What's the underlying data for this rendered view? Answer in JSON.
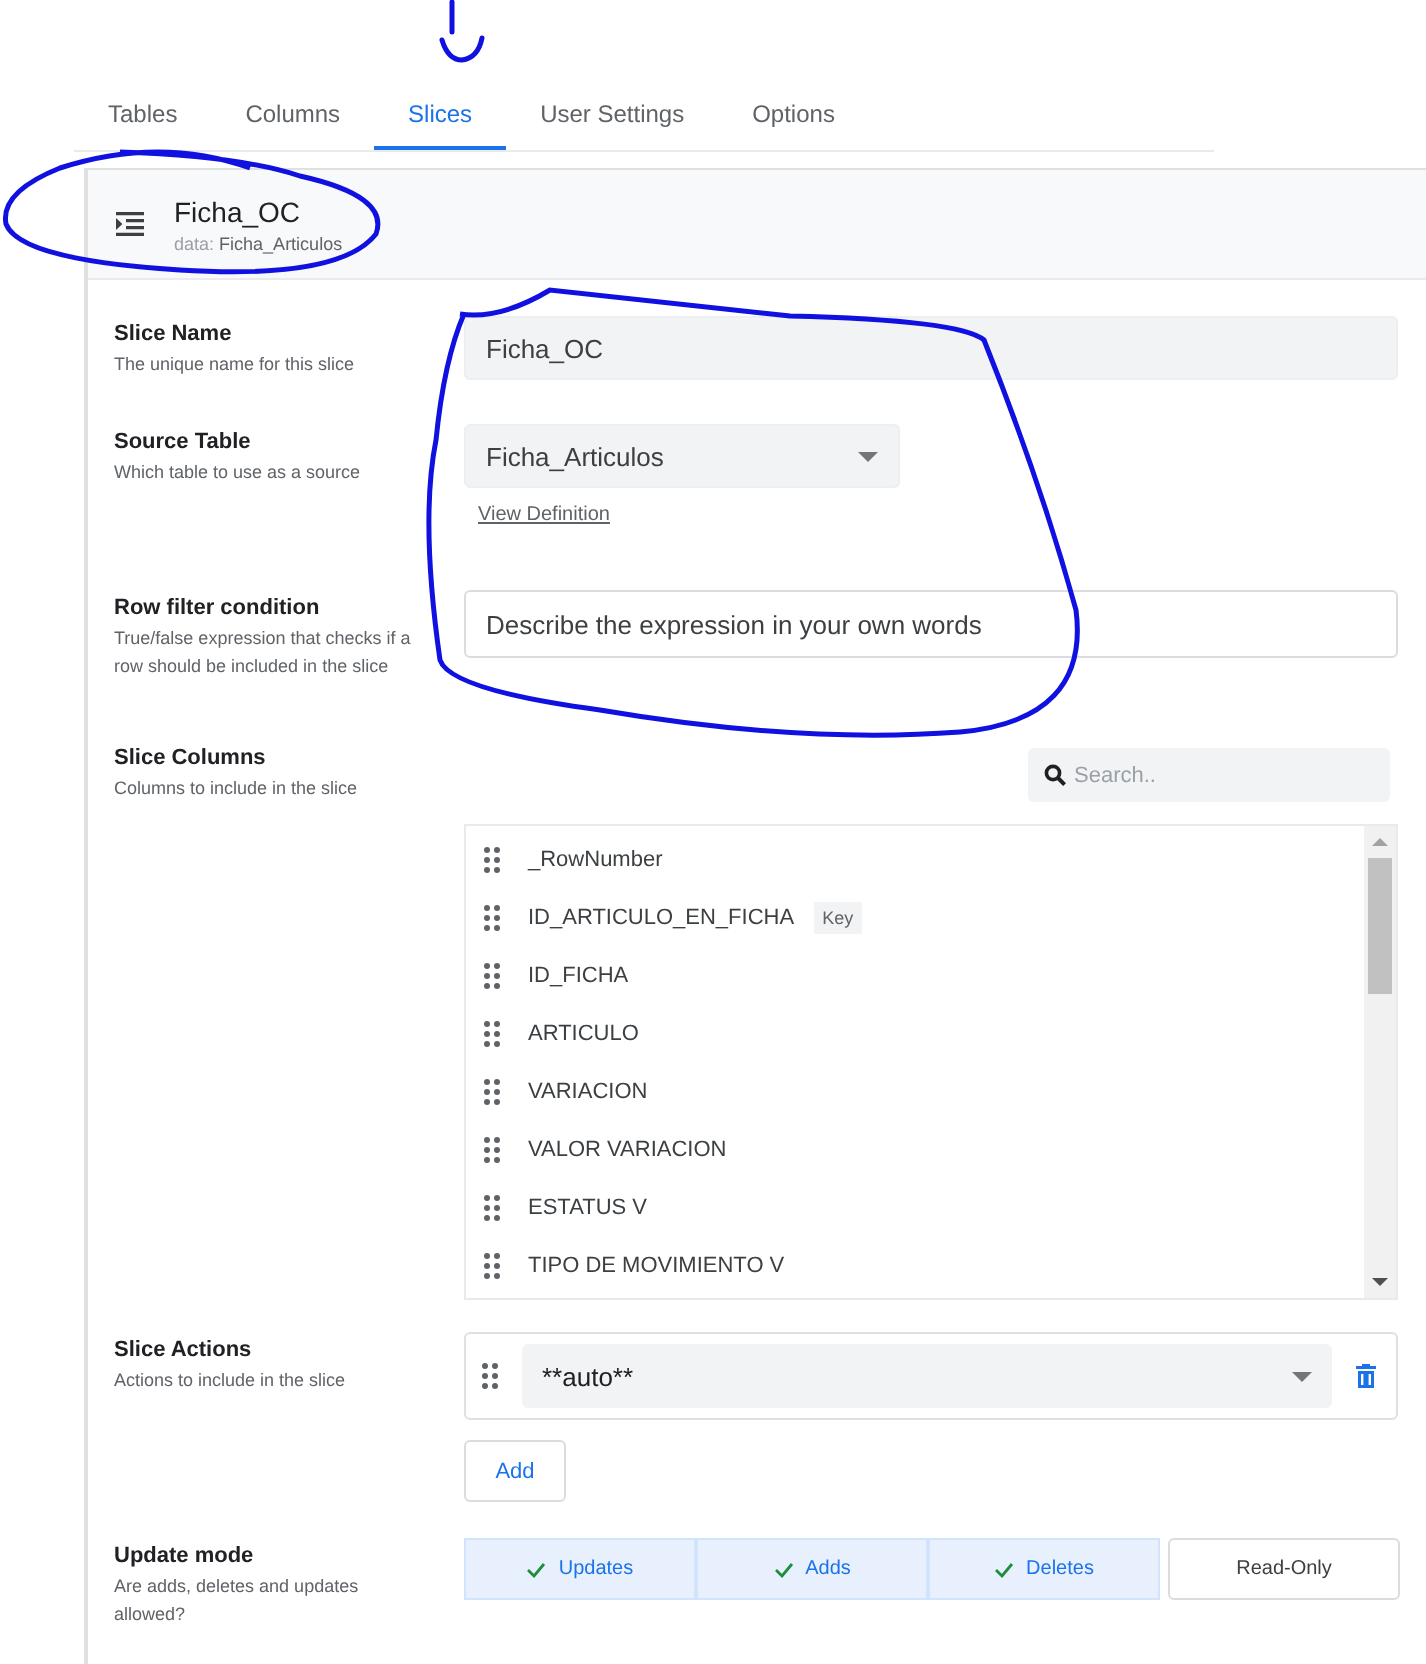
{
  "tabs": [
    {
      "label": "Tables",
      "selected": false
    },
    {
      "label": "Columns",
      "selected": false
    },
    {
      "label": "Slices",
      "selected": true
    },
    {
      "label": "User Settings",
      "selected": false
    },
    {
      "label": "Options",
      "selected": false
    }
  ],
  "slice": {
    "title": "Ficha_OC",
    "source_prefix": "data:",
    "source_name": "Ficha_Articulos"
  },
  "slice_name": {
    "label": "Slice Name",
    "help": "The unique name for this slice",
    "value": "Ficha_OC"
  },
  "source_table": {
    "label": "Source Table",
    "help": "Which table to use as a source",
    "value": "Ficha_Articulos",
    "link": "View Definition"
  },
  "row_filter": {
    "label": "Row filter condition",
    "help": "True/false expression that checks if a row should be included in the slice",
    "placeholder": "Describe the expression in your own words"
  },
  "slice_columns": {
    "label": "Slice Columns",
    "help": "Columns to include in the slice",
    "search_placeholder": "Search..",
    "items": [
      {
        "name": "_RowNumber"
      },
      {
        "name": "ID_ARTICULO_EN_FICHA",
        "badge": "Key"
      },
      {
        "name": "ID_FICHA"
      },
      {
        "name": "ARTICULO"
      },
      {
        "name": "VARIACION"
      },
      {
        "name": "VALOR VARIACION"
      },
      {
        "name": "ESTATUS V"
      },
      {
        "name": "TIPO DE MOVIMIENTO V"
      }
    ]
  },
  "slice_actions": {
    "label": "Slice Actions",
    "help": "Actions to include in the slice",
    "items": [
      {
        "value": "**auto**"
      }
    ],
    "add_button": "Add"
  },
  "update_mode": {
    "label": "Update mode",
    "help": "Are adds, deletes and updates allowed?",
    "options": [
      {
        "label": "Updates",
        "selected": true
      },
      {
        "label": "Adds",
        "selected": true
      },
      {
        "label": "Deletes",
        "selected": true
      },
      {
        "label": "Read-Only",
        "selected": false
      }
    ]
  }
}
